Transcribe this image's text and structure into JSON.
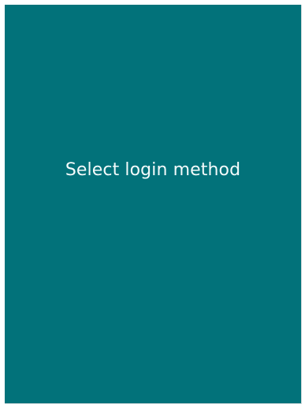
{
  "login_panel": {
    "title": "Select login method",
    "background_color": "#02727a",
    "text_color": "#f4fbfb"
  }
}
